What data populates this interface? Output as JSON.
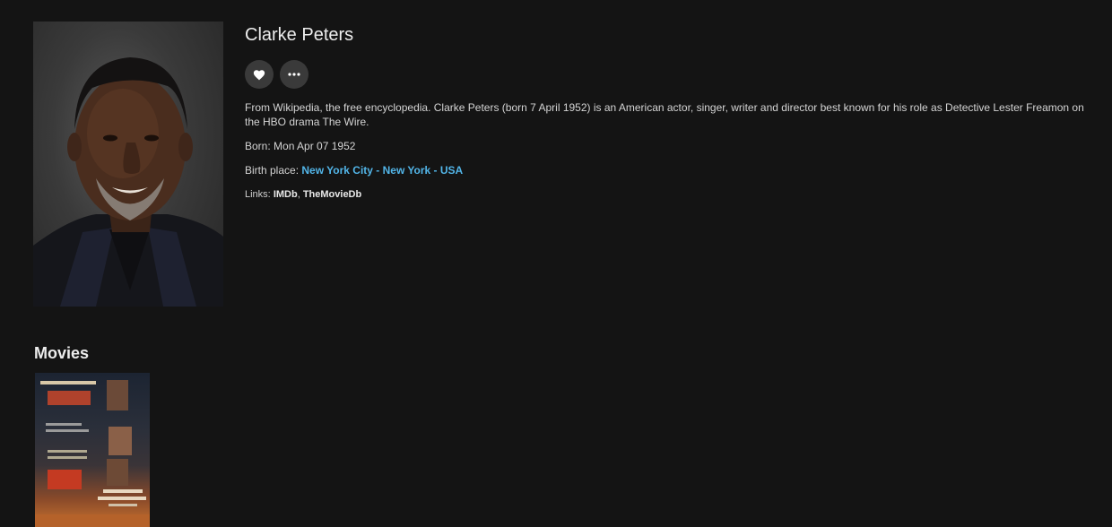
{
  "person": {
    "name": "Clarke Peters",
    "overview": "From Wikipedia, the free encyclopedia. Clarke Peters (born 7 April 1952) is an American actor, singer, writer and director best known for his role as Detective Lester Freamon on the HBO drama The Wire.",
    "born_label": "Born:",
    "born_value": "Mon Apr 07 1952",
    "birthplace_label": "Birth place:",
    "birthplace_value": "New York City - New York - USA",
    "links_label": "Links:",
    "links": [
      "IMDb",
      "TheMovieDb"
    ],
    "links_separator": ","
  },
  "actions": {
    "favorite_icon": "heart-icon",
    "more_icon": "more-horizontal-icon"
  },
  "movies": {
    "title": "Movies",
    "poster": {
      "text_lines": [
        "本屆金球獎最大贏家",
        "4項大獎",
        "意外",
        "THREE BILLBOARDS"
      ]
    }
  },
  "colors": {
    "background": "#141414",
    "accent_link": "#52b5e8",
    "button_bg": "#3a3a3a"
  }
}
